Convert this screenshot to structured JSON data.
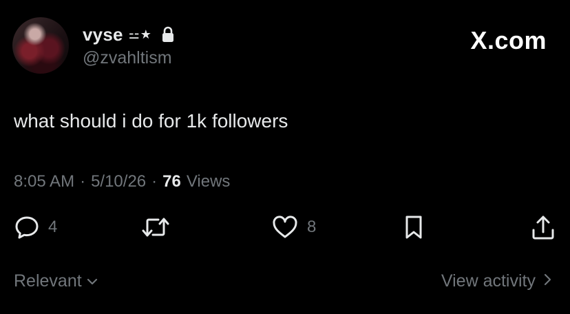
{
  "author": {
    "display_name": "vyse",
    "name_emoji": "⚍★",
    "handle": "@zvahltism"
  },
  "brand": {
    "label": "X.com"
  },
  "tweet": {
    "text": "what should i do for 1k followers"
  },
  "meta": {
    "time": "8:05 AM",
    "separator1": "·",
    "date": "5/10/26",
    "separator2": "·",
    "views_count": "76",
    "views_label": "Views"
  },
  "actions": {
    "reply_count": "4",
    "retweet_count": "",
    "like_count": "8"
  },
  "footer": {
    "sort_label": "Relevant",
    "activity_label": "View activity"
  },
  "colors": {
    "background": "#000000",
    "primary_text": "#e7e9ea",
    "secondary_text": "#71767b"
  },
  "icons": {
    "verified_lock": "lock-icon",
    "reply": "reply-icon",
    "retweet": "retweet-icon",
    "like": "heart-icon",
    "bookmark": "bookmark-icon",
    "share": "share-icon",
    "sort_chevron": "chevron-down-icon",
    "activity_chevron": "chevron-right-icon"
  }
}
